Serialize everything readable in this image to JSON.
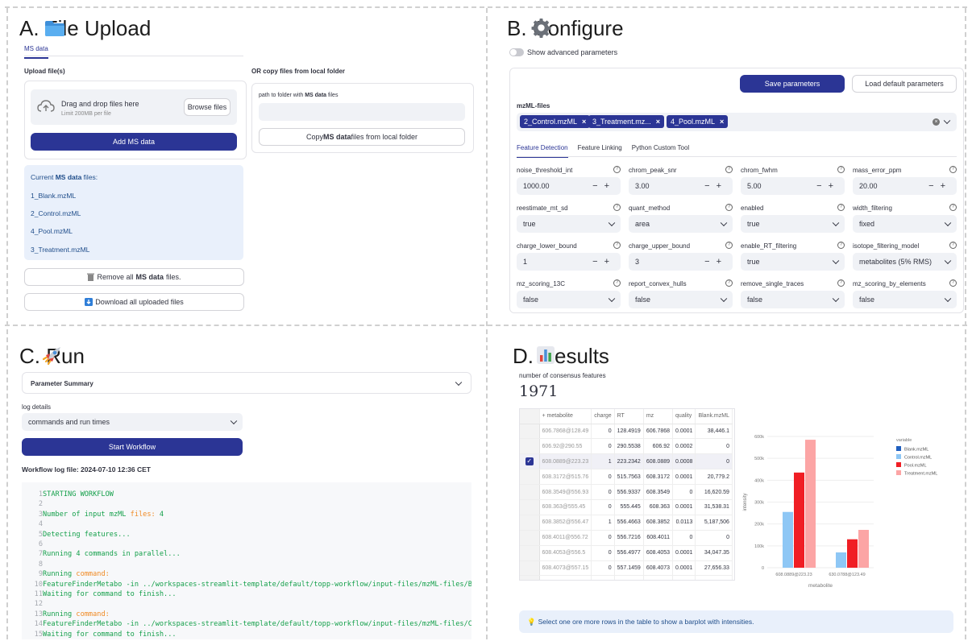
{
  "panel_a": {
    "title": "A.  File Upload",
    "tab": "MS data",
    "upload_label": "Upload file(s)",
    "drop_text": "Drag and drop files here",
    "limit_text": "Limit 200MB per file",
    "browse_label": "Browse files",
    "add_button": "Add MS data",
    "copy_label": "OR copy files from local folder",
    "path_label_pre": "path to folder with ",
    "path_label_bold": "MS data",
    "path_label_post": " files",
    "copy_btn_pre": "Copy ",
    "copy_btn_bold": "MS data",
    "copy_btn_post": " files from local folder",
    "current_pre": "Current ",
    "current_bold": "MS data",
    "current_post": " files:",
    "files": [
      "1_Blank.mzML",
      "2_Control.mzML",
      "4_Pool.mzML",
      "3_Treatment.mzML"
    ],
    "remove_pre": "Remove all ",
    "remove_bold": "MS data",
    "remove_post": " files.",
    "download_label": "Download all uploaded files"
  },
  "panel_b": {
    "title": "B.  Configure",
    "advanced_label": "Show advanced parameters",
    "save_label": "Save parameters",
    "load_label": "Load default parameters",
    "files_label": "mzML-files",
    "chips": [
      "2_Control.mzML",
      "3_Treatment.mz...",
      "4_Pool.mzML"
    ],
    "tabs": [
      "Feature Detection",
      "Feature Linking",
      "Python Custom Tool"
    ],
    "params": [
      {
        "label": "noise_threshold_int",
        "value": "1000.00",
        "kind": "number"
      },
      {
        "label": "chrom_peak_snr",
        "value": "3.00",
        "kind": "number"
      },
      {
        "label": "chrom_fwhm",
        "value": "5.00",
        "kind": "number"
      },
      {
        "label": "mass_error_ppm",
        "value": "20.00",
        "kind": "number"
      },
      {
        "label": "reestimate_mt_sd",
        "value": "true",
        "kind": "select"
      },
      {
        "label": "quant_method",
        "value": "area",
        "kind": "select"
      },
      {
        "label": "enabled",
        "value": "true",
        "kind": "select"
      },
      {
        "label": "width_filtering",
        "value": "fixed",
        "kind": "select"
      },
      {
        "label": "charge_lower_bound",
        "value": "1",
        "kind": "number"
      },
      {
        "label": "charge_upper_bound",
        "value": "3",
        "kind": "number"
      },
      {
        "label": "enable_RT_filtering",
        "value": "true",
        "kind": "select"
      },
      {
        "label": "isotope_filtering_model",
        "value": "metabolites (5% RMS)",
        "kind": "select"
      },
      {
        "label": "mz_scoring_13C",
        "value": "false",
        "kind": "select"
      },
      {
        "label": "report_convex_hulls",
        "value": "false",
        "kind": "select"
      },
      {
        "label": "remove_single_traces",
        "value": "false",
        "kind": "select"
      },
      {
        "label": "mz_scoring_by_elements",
        "value": "false",
        "kind": "select"
      }
    ]
  },
  "panel_c": {
    "title": "C.  Run",
    "summary_label": "Parameter Summary",
    "log_label": "log details",
    "log_value": "commands and run times",
    "start_label": "Start Workflow",
    "log_file": "Workflow log file: 2024-07-10 12:36 CET",
    "log_lines": [
      {
        "n": "1",
        "t": "STARTING WORKFLOW"
      },
      {
        "n": "2",
        "t": ""
      },
      {
        "n": "3",
        "t": "Number of input mzML ",
        "o": "files:",
        "t2": " 4"
      },
      {
        "n": "4",
        "t": ""
      },
      {
        "n": "5",
        "t": "Detecting features..."
      },
      {
        "n": "6",
        "t": ""
      },
      {
        "n": "7",
        "t": "Running 4 commands in parallel..."
      },
      {
        "n": "8",
        "t": ""
      },
      {
        "n": "9",
        "t": "Running ",
        "o": "command:",
        "t2": ""
      },
      {
        "n": "10",
        "t": "FeatureFinderMetabo -in ../workspaces-streamlit-template/default/topp-workflow/input-files/mzML-files/Blank.mzML -"
      },
      {
        "n": "11",
        "t": "Waiting for command to finish..."
      },
      {
        "n": "12",
        "t": ""
      },
      {
        "n": "13",
        "t": "Running ",
        "o": "command:",
        "t2": ""
      },
      {
        "n": "14",
        "t": "FeatureFinderMetabo -in ../workspaces-streamlit-template/default/topp-workflow/input-files/mzML-files/Control.mzML"
      },
      {
        "n": "15",
        "t": "Waiting for command to finish..."
      }
    ]
  },
  "panel_d": {
    "title": "D.  Results",
    "count_label": "number of consensus features",
    "count_value": "1971",
    "columns": [
      "metabolite",
      "charge",
      "RT",
      "mz",
      "quality",
      "Blank.mzML"
    ],
    "rows": [
      [
        "606.7868@128.49",
        "0",
        "128.4919",
        "606.7868",
        "0.0001",
        "38,446.1"
      ],
      [
        "606.92@290.55",
        "0",
        "290.5538",
        "606.92",
        "0.0002",
        "0"
      ],
      [
        "608.0889@223.23",
        "1",
        "223.2342",
        "608.0889",
        "0.0008",
        "0"
      ],
      [
        "608.3172@515.76",
        "0",
        "515.7563",
        "608.3172",
        "0.0001",
        "20,779.2"
      ],
      [
        "608.3549@556.93",
        "0",
        "556.9337",
        "608.3549",
        "0",
        "16,620.59"
      ],
      [
        "608.363@555.45",
        "0",
        "555.445",
        "608.363",
        "0.0001",
        "31,538.31"
      ],
      [
        "608.3852@556.47",
        "1",
        "556.4663",
        "608.3852",
        "0.0113",
        "5,187,506"
      ],
      [
        "608.4011@556.72",
        "0",
        "556.7216",
        "608.4011",
        "0",
        "0"
      ],
      [
        "608.4053@556.5",
        "0",
        "556.4977",
        "608.4053",
        "0.0001",
        "34,047.35"
      ],
      [
        "608.4073@557.15",
        "0",
        "557.1459",
        "608.4073",
        "0.0001",
        "27,656.33"
      ],
      [
        "608.4144@555.51",
        "0",
        "555.5073",
        "608.4144",
        "0",
        "0"
      ]
    ],
    "selected_row": 2,
    "info_text": "Select one ore more rows in the table to show a barplot with intensities."
  },
  "chart_data": {
    "type": "bar",
    "categories": [
      "608.0889@223.23",
      "630.0788@123.49"
    ],
    "series": [
      {
        "name": "Blank.mzML",
        "color": "#1f5fbf",
        "values": [
          0,
          0
        ]
      },
      {
        "name": "Control.mzML",
        "color": "#8ec7f5",
        "values": [
          255000,
          70000
        ]
      },
      {
        "name": "Pool.mzML",
        "color": "#f01e24",
        "values": [
          435000,
          130000
        ]
      },
      {
        "name": "Treatment.mzML",
        "color": "#fca5a5",
        "values": [
          585000,
          173000
        ]
      }
    ],
    "ylim": [
      0,
      600000
    ],
    "yticks": [
      "0",
      "100k",
      "200k",
      "300k",
      "400k",
      "500k",
      "600k"
    ],
    "ylabel": "intensity",
    "xlabel": "metabolite",
    "legend_title": "variable",
    "legend_position": "top-right"
  },
  "colors": {
    "accent": "#2b3595",
    "code_green": "#15a04b",
    "code_orange": "#f08a24"
  }
}
